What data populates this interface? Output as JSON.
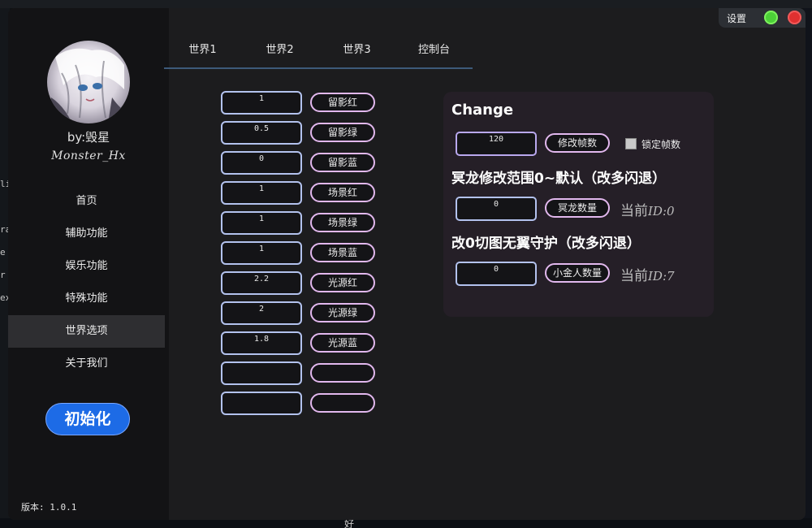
{
  "background": {
    "fragments": [
      "li",
      "ra",
      "e",
      "r",
      "ex",
      "好"
    ]
  },
  "window": {
    "author_line1": "by:毁星",
    "author_line2": "Monster_Hx",
    "version": "版本: 1.0.1",
    "init_button": "初始化",
    "topbar": {
      "settings_label": "设置",
      "colors": {
        "green": "#4cd137",
        "red": "#e03030"
      }
    }
  },
  "sidebar": {
    "items": [
      {
        "label": "首页",
        "active": false
      },
      {
        "label": "辅助功能",
        "active": false
      },
      {
        "label": "娱乐功能",
        "active": false
      },
      {
        "label": "特殊功能",
        "active": false
      },
      {
        "label": "世界选项",
        "active": true
      },
      {
        "label": "关于我们",
        "active": false
      }
    ]
  },
  "tabs": [
    "世界1",
    "世界2",
    "世界3",
    "控制台"
  ],
  "world_rows": [
    {
      "value": "1",
      "button": "留影红"
    },
    {
      "value": "0.5",
      "button": "留影绿"
    },
    {
      "value": "0",
      "button": "留影蓝"
    },
    {
      "value": "1",
      "button": "场景红"
    },
    {
      "value": "1",
      "button": "场景绿"
    },
    {
      "value": "1",
      "button": "场景蓝"
    },
    {
      "value": "2.2",
      "button": "光源红"
    },
    {
      "value": "2",
      "button": "光源绿"
    },
    {
      "value": "1.8",
      "button": "光源蓝"
    },
    {
      "value": "",
      "button": ""
    },
    {
      "value": "",
      "button": ""
    }
  ],
  "change_panel": {
    "title": "Change",
    "fps_value": "120",
    "fps_button": "修改帧数",
    "lock_fps_label": "锁定帧数",
    "dragon_heading": "冥龙修改范围0~默认（改多闪退）",
    "dragon_value": "0",
    "dragon_button": "冥龙数量",
    "dragon_current_prefix": "当前",
    "dragon_current_id": "ID:0",
    "guard_heading": "改0切图无翼守护（改多闪退）",
    "guard_value": "0",
    "guard_button": "小金人数量",
    "guard_current_prefix": "当前",
    "guard_current_id": "ID:7"
  }
}
